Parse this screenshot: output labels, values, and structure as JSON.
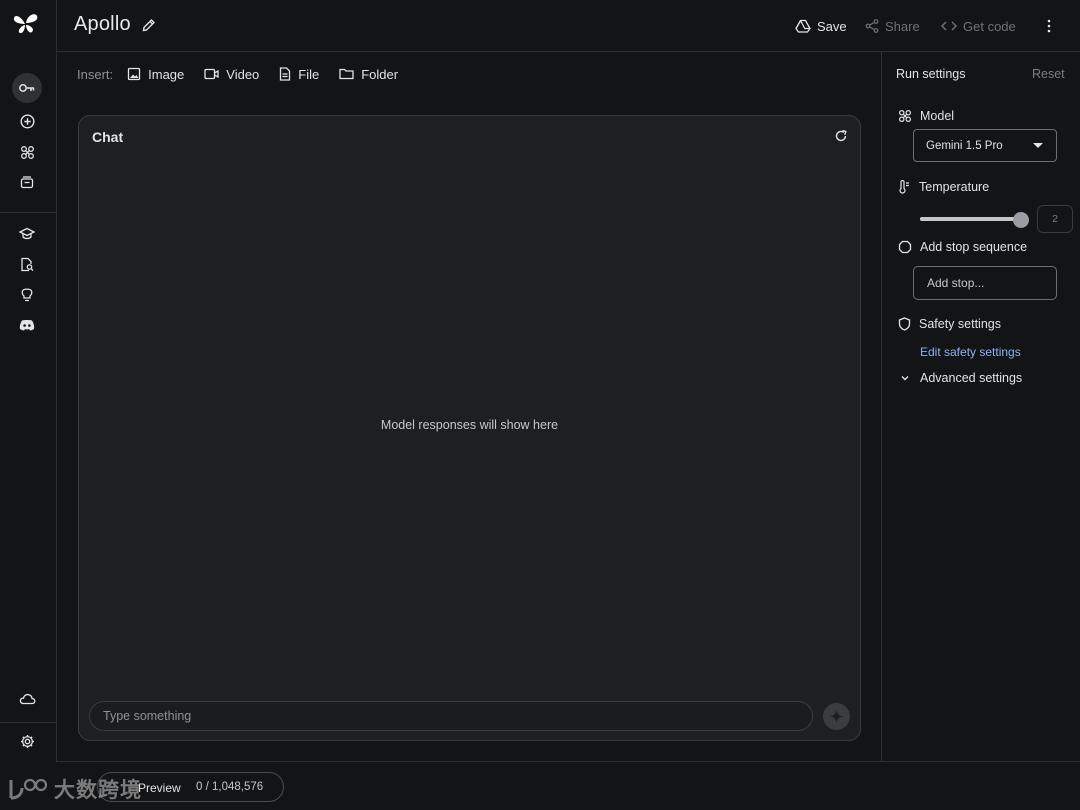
{
  "app": {
    "title": "Apollo"
  },
  "header": {
    "save_label": "Save",
    "share_label": "Share",
    "code_label": "Get code"
  },
  "rail": {
    "items": [
      {
        "icon": "key-icon",
        "active": true
      },
      {
        "icon": "add-circle-icon"
      },
      {
        "icon": "tuning-icon"
      },
      {
        "icon": "library-icon"
      },
      {
        "icon": "school-icon"
      },
      {
        "icon": "document-search-icon"
      },
      {
        "icon": "lightbulb-icon"
      },
      {
        "icon": "discord-icon"
      },
      {
        "icon": "cloud-icon"
      },
      {
        "icon": "settings-icon"
      }
    ]
  },
  "insert": {
    "label": "Insert:",
    "items": [
      {
        "label": "Image",
        "icon": "image-icon"
      },
      {
        "label": "Video",
        "icon": "video-icon"
      },
      {
        "label": "File",
        "icon": "file-icon"
      },
      {
        "label": "Folder",
        "icon": "folder-icon"
      }
    ]
  },
  "chat": {
    "title": "Chat",
    "empty_text": "Model responses will show here",
    "input_placeholder": "Type something"
  },
  "run_settings": {
    "title": "Run settings",
    "reset_label": "Reset",
    "model_label": "Model",
    "model_value": "Gemini 1.5 Pro",
    "temperature_label": "Temperature",
    "temperature_value": "2",
    "temperature_fraction": 1.0,
    "stop_sequence_label": "Add stop sequence",
    "stop_placeholder": "Add stop...",
    "safety_label": "Safety settings",
    "edit_safety_label": "Edit safety settings",
    "advanced_label": "Advanced settings"
  },
  "bottom": {
    "preview_label": "Preview",
    "token_count": "0 / 1,048,576"
  },
  "watermark": {
    "text": "大数跨境"
  },
  "colors": {
    "accent_link": "#8ab4f8",
    "background": "#131416",
    "panel": "#1e1f21"
  }
}
